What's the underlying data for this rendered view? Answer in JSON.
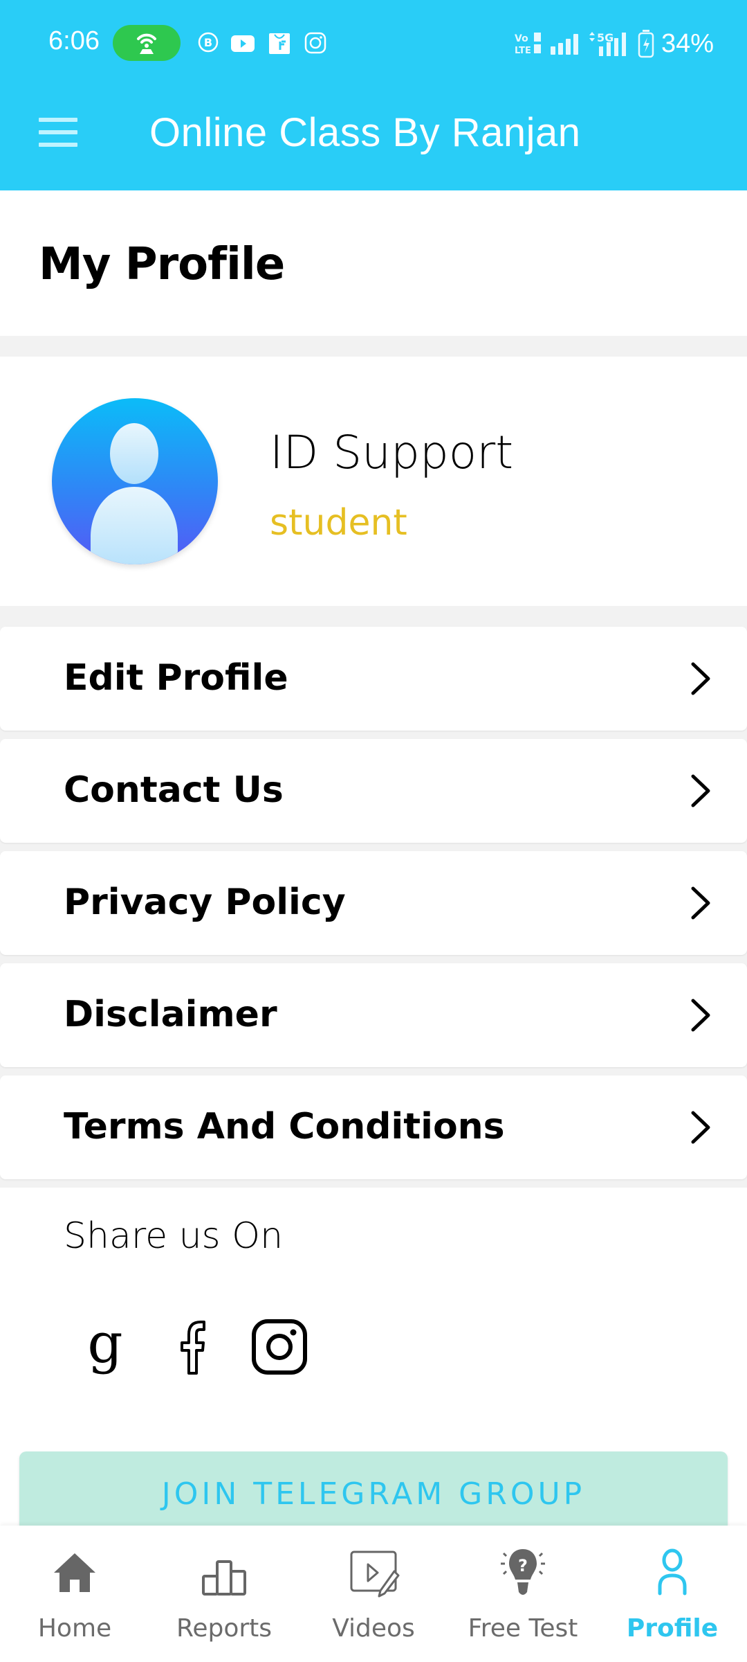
{
  "status_bar": {
    "time": "6:06",
    "battery": "34%",
    "icons": [
      "hotspot-icon",
      "business-chat-icon",
      "youtube-icon",
      "flipkart-icon",
      "instagram-icon",
      "volte-icon",
      "signal-icon",
      "5g-signal-icon",
      "battery-charging-icon"
    ],
    "network_label": "5G",
    "volte_label": "VoLTE"
  },
  "app_bar": {
    "title": "Online Class By Ranjan",
    "menu_icon": "hamburger-menu-icon"
  },
  "page": {
    "title": "My Profile"
  },
  "profile": {
    "name": "ID Support",
    "role": "student",
    "role_color": "#e6bf23"
  },
  "menu": [
    {
      "label": "Edit Profile"
    },
    {
      "label": "Contact Us"
    },
    {
      "label": "Privacy Policy"
    },
    {
      "label": "Disclaimer"
    },
    {
      "label": "Terms And Conditions"
    }
  ],
  "share": {
    "label": "Share us On",
    "networks": [
      "google",
      "facebook",
      "instagram"
    ]
  },
  "telegram": {
    "label": "JOIN TELEGRAM GROUP",
    "bg_color": "#bfebdf",
    "text_color": "#2ec6ef"
  },
  "bottom_nav": {
    "items": [
      {
        "label": "Home",
        "icon": "home-icon",
        "active": false
      },
      {
        "label": "Reports",
        "icon": "reports-icon",
        "active": false
      },
      {
        "label": "Videos",
        "icon": "videos-icon",
        "active": false
      },
      {
        "label": "Free Test",
        "icon": "free-test-icon",
        "active": false
      },
      {
        "label": "Profile",
        "icon": "profile-icon",
        "active": true
      }
    ],
    "active_color": "#2ec6ef",
    "inactive_color": "#6b6b6b"
  },
  "colors": {
    "primary": "#29cdf7",
    "background": "#f2f2f2"
  }
}
